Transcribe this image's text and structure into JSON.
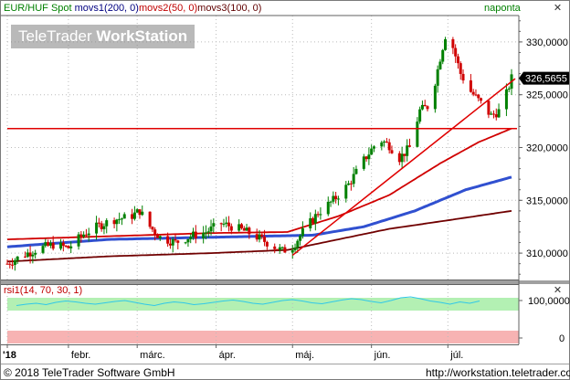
{
  "header": {
    "instrument": "EUR/HUF Spot",
    "ma1": "movs1(200, 0)",
    "ma2": "movs2(50, 0)",
    "ma3": "movs3(100, 0)",
    "period": "naponta"
  },
  "watermark": {
    "brand": "TeleTrader ",
    "product": "WorkStation"
  },
  "rsi": {
    "label": "rsi1(14, 70, 30, 1)",
    "ticks": [
      "100,0000",
      "0"
    ],
    "ylim": [
      0,
      100
    ],
    "levels": [
      70,
      30
    ]
  },
  "footer": {
    "copyright": "© 2018 TeleTrader Software GmbH",
    "url": "http://workstation.teletrader.com"
  },
  "last_price": "326,5655",
  "colors": {
    "up": "#008000",
    "down": "#d00000",
    "ma1": "#3050d0",
    "ma2": "#d00000",
    "ma3": "#700000",
    "trend": "#e00000",
    "rsi": "#30c8e8",
    "flag": "#000000"
  },
  "chart_data": {
    "type": "candlestick",
    "y_ticks": [
      "330,0000",
      "325,0000",
      "320,0000",
      "315,0000",
      "310,0000"
    ],
    "ylim": [
      307.5,
      332.5
    ],
    "x_ticks": [
      "'18",
      "febr.",
      "márc.",
      "ápr.",
      "máj.",
      "jún.",
      "júl."
    ],
    "x_tick_days": [
      0,
      24,
      51,
      82,
      112,
      143,
      173
    ],
    "n_days": 199,
    "last_close": 326.5655,
    "key_closes": [
      [
        0,
        309.0
      ],
      [
        6,
        309.8
      ],
      [
        12,
        310.4
      ],
      [
        18,
        310.8
      ],
      [
        24,
        310.5
      ],
      [
        30,
        311.8
      ],
      [
        36,
        312.6
      ],
      [
        42,
        313.2
      ],
      [
        48,
        313.4
      ],
      [
        52,
        314.0
      ],
      [
        56,
        312.5
      ],
      [
        60,
        311.5
      ],
      [
        66,
        311.0
      ],
      [
        72,
        311.6
      ],
      [
        78,
        312.0
      ],
      [
        84,
        312.8
      ],
      [
        90,
        312.4
      ],
      [
        96,
        311.8
      ],
      [
        102,
        311.0
      ],
      [
        108,
        310.2
      ],
      [
        112,
        310.6
      ],
      [
        116,
        312.0
      ],
      [
        122,
        313.8
      ],
      [
        128,
        315.0
      ],
      [
        134,
        316.5
      ],
      [
        140,
        318.8
      ],
      [
        146,
        320.8
      ],
      [
        150,
        320.2
      ],
      [
        154,
        319.0
      ],
      [
        158,
        320.0
      ],
      [
        162,
        323.5
      ],
      [
        166,
        324.0
      ],
      [
        170,
        328.5
      ],
      [
        172,
        330.6
      ],
      [
        175,
        329.5
      ],
      [
        178,
        327.0
      ],
      [
        182,
        325.3
      ],
      [
        186,
        324.2
      ],
      [
        190,
        323.0
      ],
      [
        194,
        323.6
      ],
      [
        198,
        326.5655
      ]
    ],
    "series": [
      {
        "name": "movs1(200, 0)",
        "points": [
          [
            0,
            310.6
          ],
          [
            40,
            311.3
          ],
          [
            80,
            311.5
          ],
          [
            120,
            311.7
          ],
          [
            140,
            312.5
          ],
          [
            160,
            314.0
          ],
          [
            180,
            316.0
          ],
          [
            198,
            317.2
          ]
        ]
      },
      {
        "name": "movs2(50, 0)",
        "points": [
          [
            0,
            311.3
          ],
          [
            40,
            311.6
          ],
          [
            80,
            311.9
          ],
          [
            110,
            312.0
          ],
          [
            130,
            313.5
          ],
          [
            150,
            315.5
          ],
          [
            170,
            318.5
          ],
          [
            185,
            320.5
          ],
          [
            198,
            321.8
          ]
        ]
      },
      {
        "name": "movs3(100, 0)",
        "points": [
          [
            0,
            309.2
          ],
          [
            40,
            309.7
          ],
          [
            80,
            310.0
          ],
          [
            110,
            310.3
          ],
          [
            130,
            311.3
          ],
          [
            150,
            312.3
          ],
          [
            170,
            313.0
          ],
          [
            198,
            314.0
          ]
        ]
      }
    ],
    "horizontal_line": 321.8,
    "trend_line": [
      [
        112,
        309.8
      ],
      [
        198,
        326.2
      ]
    ],
    "rsi_values": [
      55,
      58,
      60,
      57,
      62,
      65,
      63,
      60,
      58,
      61,
      64,
      66,
      62,
      58,
      55,
      60,
      63,
      61,
      57,
      59,
      62,
      65,
      67,
      64,
      60,
      58,
      62,
      66,
      68,
      65,
      61,
      59,
      63,
      67,
      70,
      68,
      64,
      61,
      66,
      72,
      74,
      70,
      65,
      62,
      58,
      63,
      60,
      65
    ]
  }
}
